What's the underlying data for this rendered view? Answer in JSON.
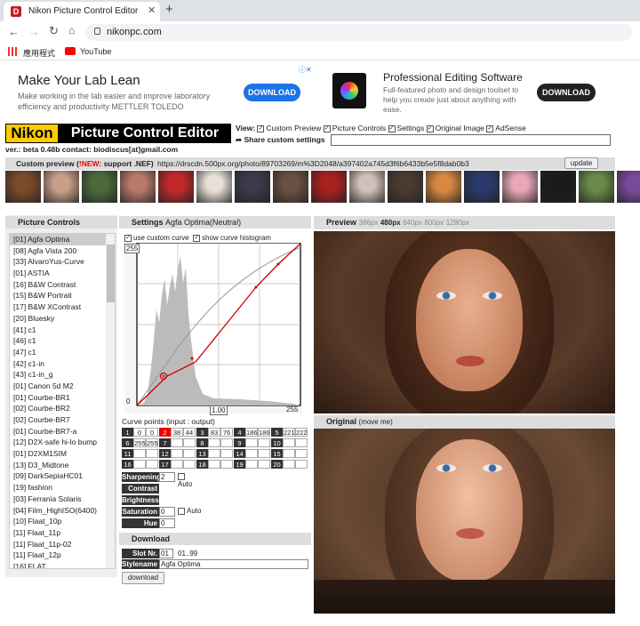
{
  "browser": {
    "tab_title": "Nikon Picture Control Editor",
    "url": "nikonpc.com",
    "bookmarks": [
      {
        "label": "應用程式",
        "icon": "apps-grid-icon"
      },
      {
        "label": "YouTube",
        "icon": "youtube-icon"
      }
    ]
  },
  "ads": [
    {
      "title": "Make Your Lab Lean",
      "body": "Make working in the lab easier and improve laboratory efficiency and productivity METTLER TOLEDO",
      "button": "DOWNLOAD"
    },
    {
      "title": "Professional Editing Software",
      "body": "Full-featured photo and design toolset to help you create just about anything with ease.",
      "button": "DOWNLOAD"
    }
  ],
  "header": {
    "logo_word": "Nikon",
    "app_title": "Picture Control Editor",
    "version_line": "ver.: beta 0.48b contact: biodiscus[at]gmail.com",
    "view_label": "View:",
    "view_options": [
      "Custom Preview",
      "Picture Controls",
      "Settings",
      "Original Image",
      "AdSense"
    ],
    "share_label": "Share custom settings"
  },
  "custom_preview": {
    "label": "Custom preview (",
    "new": "!NEW",
    "label_rest": ": support .NEF)",
    "url": "https://drscdn.500px.org/photo/89703269/m%3D2048/a397402a745d3f6b6433b5e5f8dab0b3",
    "update": "update"
  },
  "thumb_colors": [
    "#7a4a2a",
    "#c8a08a",
    "#4a6a3a",
    "#b87a6a",
    "#c02828",
    "#e8e0d8",
    "#3a3a4a",
    "#6a5040",
    "#a82020",
    "#d0c0b8",
    "#4a3a30",
    "#d88840",
    "#2a3a6a",
    "#e8a8b8",
    "#1a1a1a",
    "#6a8a4a",
    "#7a4a9a"
  ],
  "picture_controls": {
    "title": "Picture Controls",
    "items": [
      "[01] Agfa Optima",
      "[08] Agfa Vista 200",
      "[33] AlvaroYus-Curve",
      "[01] ASTIA",
      "[16] B&W Contrast",
      "[15] B&W Portrait",
      "[17] B&W XContrast",
      "[20] Bluesky",
      "[41] c1",
      "[46] c1",
      "[47] c1",
      "[42] c1-in",
      "[43] c1-in_g",
      "[01] Canon 5d M2",
      "[01] Courbe-BR1",
      "[02] Courbe-BR2",
      "[02] Courbe-BR7",
      "[01] Courbe-BR7-a",
      "[12] D2X-safe hi-lo bump",
      "[01] D2XM1SIM",
      "[13] D3_Midtone",
      "[09] DarkSepiaHC01",
      "[19] fashion",
      "[03] Ferrania Solaris",
      "[04] Film_HighISO(6400)",
      "[10] Flaat_10p",
      "[11] Flaat_11p",
      "[11] Flaat_11p-02",
      "[11] Flaat_12p",
      "[16] FLAT"
    ]
  },
  "settings": {
    "title": "Settings",
    "subtitle": "Agfa Optima(Neutral)",
    "use_curve": "use custom curve",
    "show_hist": "show curve histogram",
    "curve_top": "255",
    "curve_zero": "0",
    "curve_bottom_right": "255",
    "gamma": "1.00",
    "curve_points_label": "Curve points (input : output)",
    "points": [
      [
        "1",
        "0",
        "0"
      ],
      [
        "2",
        "38",
        "44"
      ],
      [
        "3",
        "83",
        "76"
      ],
      [
        "4",
        "186",
        "186"
      ],
      [
        "5",
        "221",
        "222"
      ],
      [
        "6",
        "255",
        "255"
      ],
      [
        "7",
        "",
        ""
      ],
      [
        "8",
        "",
        ""
      ],
      [
        "9",
        "",
        ""
      ],
      [
        "10",
        "",
        ""
      ],
      [
        "11",
        "",
        ""
      ],
      [
        "12",
        "",
        ""
      ],
      [
        "13",
        "",
        ""
      ],
      [
        "14",
        "",
        ""
      ],
      [
        "15",
        "",
        ""
      ],
      [
        "16",
        "",
        ""
      ],
      [
        "17",
        "",
        ""
      ],
      [
        "18",
        "",
        ""
      ],
      [
        "19",
        "",
        ""
      ],
      [
        "20",
        "",
        ""
      ]
    ],
    "sharpening": "Sharpening",
    "sharpening_val": "2",
    "contrast": "Contrast",
    "brightness": "Brightness",
    "saturation": "Saturation",
    "saturation_val": "0",
    "hue": "Hue",
    "hue_val": "0",
    "auto": "Auto"
  },
  "download": {
    "title": "Download",
    "slot_label": "Slot Nr.",
    "slot_val": "01",
    "slot_range": "01..99",
    "name_label": "Stylename",
    "name_val": "Agfa Optima",
    "button": "download"
  },
  "preview": {
    "title": "Preview",
    "sizes": [
      "386px",
      "480px",
      "640px",
      "800px",
      "1280px"
    ],
    "original_title": "Original",
    "original_note": "(move me)"
  }
}
